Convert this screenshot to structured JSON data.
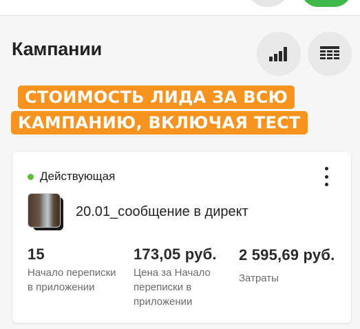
{
  "header": {
    "title": "Кампании"
  },
  "icons": {
    "chart": "bar-chart-icon",
    "table": "table-columns-icon",
    "more": "more-vertical-icon"
  },
  "colors": {
    "accent_green": "#3fb94a",
    "status_active": "#5fbd3c",
    "overlay_orange": "#f7931e"
  },
  "overlay": {
    "line1": "СТОИМОСТЬ ЛИДА ЗА ВСЮ",
    "line2": "КАМПАНИЮ, ВКЛЮЧАЯ ТЕСТ"
  },
  "campaign": {
    "status": "Действующая",
    "name": "20.01_сообщение в директ",
    "metrics": [
      {
        "value": "15",
        "label": "Начало переписки в приложении"
      },
      {
        "value": "173,05 руб.",
        "label": "Цена за Начало переписки в приложении"
      },
      {
        "value": "2 595,69 руб.",
        "label": "Затраты"
      }
    ]
  }
}
